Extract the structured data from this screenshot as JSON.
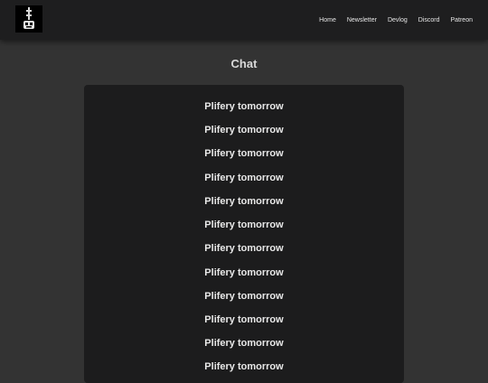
{
  "header": {
    "logo_icon": "robot-logo-icon",
    "nav": [
      {
        "label": "Home"
      },
      {
        "label": "Newsletter"
      },
      {
        "label": "Devlog"
      },
      {
        "label": "Discord"
      },
      {
        "label": "Patreon"
      }
    ]
  },
  "main": {
    "title": "Chat",
    "messages": [
      {
        "text": "Plifery tomorrow"
      },
      {
        "text": "Plifery tomorrow"
      },
      {
        "text": "Plifery tomorrow"
      },
      {
        "text": "Plifery tomorrow"
      },
      {
        "text": "Plifery tomorrow"
      },
      {
        "text": "Plifery tomorrow"
      },
      {
        "text": "Plifery tomorrow"
      },
      {
        "text": "Plifery tomorrow"
      },
      {
        "text": "Plifery tomorrow"
      },
      {
        "text": "Plifery tomorrow"
      },
      {
        "text": "Plifery tomorrow"
      },
      {
        "text": "Plifery tomorrow"
      }
    ]
  },
  "colors": {
    "page_bg": "#333333",
    "header_bg": "#1e1e1f",
    "panel_bg": "#1c1c1d",
    "text": "#e8e8e8"
  }
}
